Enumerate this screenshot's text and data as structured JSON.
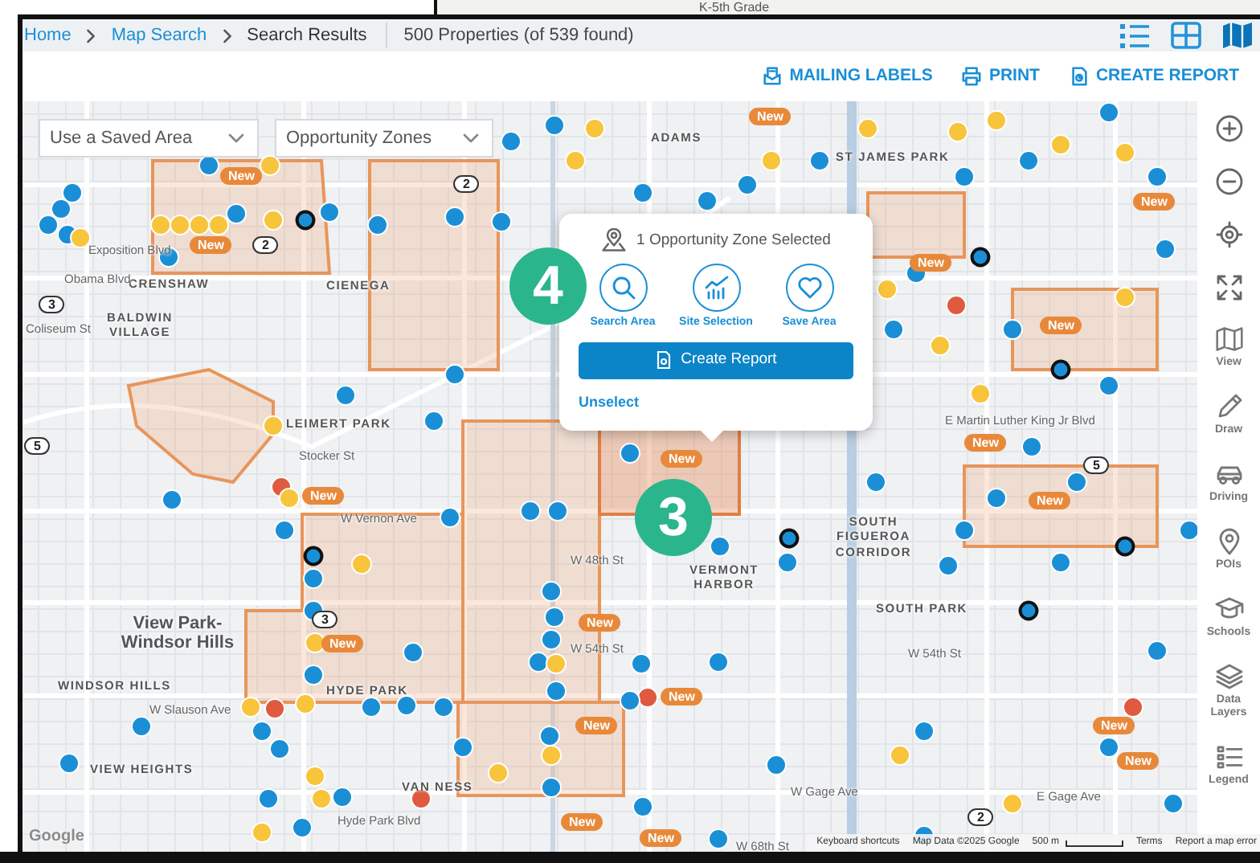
{
  "background_window": {
    "text": "K-5th Grade"
  },
  "breadcrumb": [
    {
      "label": "Home",
      "link": true
    },
    {
      "label": "Map Search",
      "link": true
    },
    {
      "label": "Search Results",
      "link": false
    }
  ],
  "result_count": "500 Properties (of 539 found)",
  "view_toggles": [
    {
      "kind": "list",
      "selected": false
    },
    {
      "kind": "grid",
      "selected": false
    },
    {
      "kind": "map",
      "selected": true
    }
  ],
  "actions": [
    {
      "kind": "mailing",
      "label": "MAILING LABELS"
    },
    {
      "kind": "print",
      "label": "PRINT"
    },
    {
      "kind": "report",
      "label": "CREATE REPORT"
    }
  ],
  "map": {
    "dropdowns": [
      {
        "value": "Use a Saved Area"
      },
      {
        "value": "Opportunity Zones"
      }
    ],
    "labels": [
      {
        "kind": "place",
        "text": "ADAMS"
      },
      {
        "kind": "place",
        "text": "ST JAMES PARK"
      },
      {
        "kind": "place",
        "text": "CRENSHAW"
      },
      {
        "kind": "place",
        "text": "BALDWIN VILLAGE"
      },
      {
        "kind": "place",
        "text": "LEIMERT PARK"
      },
      {
        "kind": "street",
        "text": "Obama Blvd"
      },
      {
        "kind": "street",
        "text": "Coliseum St"
      },
      {
        "kind": "street",
        "text": "Exposition Blvd"
      },
      {
        "kind": "street",
        "text": "Stocker St"
      },
      {
        "kind": "street",
        "text": "W Vernon Ave"
      },
      {
        "kind": "street",
        "text": "W 48th St"
      },
      {
        "kind": "street",
        "text": "W 54th St"
      },
      {
        "kind": "district",
        "text": "View Park-Windsor Hills"
      },
      {
        "kind": "place",
        "text": "WINDSOR HILLS"
      },
      {
        "kind": "street",
        "text": "W Slauson Ave"
      },
      {
        "kind": "place",
        "text": "HYDE PARK"
      },
      {
        "kind": "place",
        "text": "VIEW HEIGHTS"
      },
      {
        "kind": "place",
        "text": "VAN NESS"
      },
      {
        "kind": "street",
        "text": "Hyde Park Blvd"
      },
      {
        "kind": "place",
        "text": "VERMONT HARBOR"
      },
      {
        "kind": "place",
        "text": "SOUTH FIGUEROA CORRIDOR"
      },
      {
        "kind": "place",
        "text": "SOUTH PARK"
      },
      {
        "kind": "street",
        "text": "W 54th St"
      },
      {
        "kind": "street",
        "text": "W Gage Ave"
      },
      {
        "kind": "street",
        "text": "E Gage Ave"
      },
      {
        "kind": "street",
        "text": "W 68th St"
      },
      {
        "kind": "street",
        "text": "E Martin Luther King Jr Blvd"
      },
      {
        "kind": "place",
        "text": "CIENEGA"
      }
    ],
    "route_shields": [
      "2",
      "2",
      "3",
      "5",
      "3",
      "2",
      "5"
    ],
    "markers": [
      {
        "color": "#1b8fd6",
        "ringed": false
      },
      {
        "color": "#1b8fd6",
        "ringed": false
      },
      {
        "color": "#1b8fd6",
        "ringed": false
      },
      {
        "color": "#1b8fd6",
        "ringed": false
      },
      {
        "color": "#1b8fd6",
        "ringed": false
      },
      {
        "color": "#1b8fd6",
        "ringed": false
      },
      {
        "color": "#f8c43c",
        "ringed": false
      },
      {
        "color": "#f8c43c",
        "ringed": false
      },
      {
        "color": "#f8c43c",
        "ringed": false
      },
      {
        "color": "#f8c43c",
        "ringed": false
      },
      {
        "color": "#f8c43c",
        "ringed": false
      },
      {
        "color": "#1b8fd6",
        "ringed": false
      },
      {
        "color": "#f8c43c",
        "ringed": false
      },
      {
        "color": "#f8c43c",
        "ringed": false
      },
      {
        "color": "#1b8fd6",
        "ringed": false
      },
      {
        "color": "#1b8fd6",
        "ringed": true
      },
      {
        "color": "#1b8fd6",
        "ringed": false
      },
      {
        "color": "#1b8fd6",
        "ringed": false
      },
      {
        "color": "#1b8fd6",
        "ringed": false
      },
      {
        "color": "#1b8fd6",
        "ringed": false
      },
      {
        "color": "#1b8fd6",
        "ringed": false
      },
      {
        "color": "#f8c43c",
        "ringed": false
      },
      {
        "color": "#f8c43c",
        "ringed": false
      },
      {
        "color": "#1b8fd6",
        "ringed": false
      },
      {
        "color": "#1b8fd6",
        "ringed": false
      },
      {
        "color": "#1b8fd6",
        "ringed": false
      },
      {
        "color": "#f8c43c",
        "ringed": false
      },
      {
        "color": "#1b8fd6",
        "ringed": false
      },
      {
        "color": "#f8c43c",
        "ringed": false
      },
      {
        "color": "#f8c43c",
        "ringed": false
      },
      {
        "color": "#1b8fd6",
        "ringed": false
      },
      {
        "color": "#f8c43c",
        "ringed": false
      },
      {
        "color": "#1b8fd6",
        "ringed": false
      },
      {
        "color": "#f8c43c",
        "ringed": false
      },
      {
        "color": "#1b8fd6",
        "ringed": false
      },
      {
        "color": "#f8c43c",
        "ringed": false
      },
      {
        "color": "#1b8fd6",
        "ringed": false
      },
      {
        "color": "#1b8fd6",
        "ringed": true
      },
      {
        "color": "#e05a3f",
        "ringed": false
      },
      {
        "color": "#1b8fd6",
        "ringed": false
      },
      {
        "color": "#f8c43c",
        "ringed": false
      },
      {
        "color": "#1b8fd6",
        "ringed": false
      },
      {
        "color": "#f8c43c",
        "ringed": false
      },
      {
        "color": "#1b8fd6",
        "ringed": false
      },
      {
        "color": "#1b8fd6",
        "ringed": true
      },
      {
        "color": "#f8c43c",
        "ringed": false
      },
      {
        "color": "#1b8fd6",
        "ringed": false
      },
      {
        "color": "#f8c43c",
        "ringed": false
      },
      {
        "color": "#1b8fd6",
        "ringed": false
      },
      {
        "color": "#1b8fd6",
        "ringed": false
      },
      {
        "color": "#1b8fd6",
        "ringed": false
      },
      {
        "color": "#1b8fd6",
        "ringed": false
      },
      {
        "color": "#1b8fd6",
        "ringed": false
      },
      {
        "color": "#f8c43c",
        "ringed": false
      },
      {
        "color": "#e05a3f",
        "ringed": false
      },
      {
        "color": "#f8c43c",
        "ringed": false
      },
      {
        "color": "#1b8fd6",
        "ringed": false
      },
      {
        "color": "#1b8fd6",
        "ringed": false
      },
      {
        "color": "#1b8fd6",
        "ringed": false
      },
      {
        "color": "#1b8fd6",
        "ringed": false
      },
      {
        "color": "#1b8fd6",
        "ringed": false
      },
      {
        "color": "#1b8fd6",
        "ringed": true
      },
      {
        "color": "#f8c43c",
        "ringed": false
      },
      {
        "color": "#1b8fd6",
        "ringed": false
      },
      {
        "color": "#1b8fd6",
        "ringed": false
      },
      {
        "color": "#f8c43c",
        "ringed": false
      },
      {
        "color": "#1b8fd6",
        "ringed": false
      },
      {
        "color": "#1b8fd6",
        "ringed": false
      },
      {
        "color": "#1b8fd6",
        "ringed": false
      },
      {
        "color": "#1b8fd6",
        "ringed": false
      },
      {
        "color": "#1b8fd6",
        "ringed": false
      },
      {
        "color": "#1b8fd6",
        "ringed": false
      },
      {
        "color": "#f8c43c",
        "ringed": false
      },
      {
        "color": "#1b8fd6",
        "ringed": false
      },
      {
        "color": "#f8c43c",
        "ringed": false
      },
      {
        "color": "#e05a3f",
        "ringed": false
      },
      {
        "color": "#f8c43c",
        "ringed": false
      },
      {
        "color": "#1b8fd6",
        "ringed": false
      },
      {
        "color": "#1b8fd6",
        "ringed": false
      },
      {
        "color": "#1b8fd6",
        "ringed": false
      },
      {
        "color": "#1b8fd6",
        "ringed": false
      },
      {
        "color": "#1b8fd6",
        "ringed": false
      },
      {
        "color": "#1b8fd6",
        "ringed": false
      },
      {
        "color": "#1b8fd6",
        "ringed": false
      },
      {
        "color": "#1b8fd6",
        "ringed": false
      },
      {
        "color": "#1b8fd6",
        "ringed": false
      },
      {
        "color": "#f8c43c",
        "ringed": false
      },
      {
        "color": "#f8c43c",
        "ringed": false
      },
      {
        "color": "#1b8fd6",
        "ringed": false
      },
      {
        "color": "#e05a3f",
        "ringed": false
      },
      {
        "color": "#1b8fd6",
        "ringed": false
      },
      {
        "color": "#1b8fd6",
        "ringed": false
      },
      {
        "color": "#1b8fd6",
        "ringed": false
      },
      {
        "color": "#1b8fd6",
        "ringed": false
      },
      {
        "color": "#1b8fd6",
        "ringed": false
      },
      {
        "color": "#1b8fd6",
        "ringed": true
      },
      {
        "color": "#1b8fd6",
        "ringed": false
      },
      {
        "color": "#1b8fd6",
        "ringed": false
      },
      {
        "color": "#1b8fd6",
        "ringed": false
      },
      {
        "color": "#1b8fd6",
        "ringed": false
      },
      {
        "color": "#1b8fd6",
        "ringed": false
      },
      {
        "color": "#f8c43c",
        "ringed": false
      },
      {
        "color": "#f8c43c",
        "ringed": false
      },
      {
        "color": "#1b8fd6",
        "ringed": false
      },
      {
        "color": "#f8c43c",
        "ringed": false
      },
      {
        "color": "#1b8fd6",
        "ringed": false
      },
      {
        "color": "#e05a3f",
        "ringed": false
      },
      {
        "color": "#e05a3f",
        "ringed": false
      },
      {
        "color": "#1b8fd6",
        "ringed": false
      },
      {
        "color": "#1b8fd6",
        "ringed": false
      },
      {
        "color": "#f8c43c",
        "ringed": false
      },
      {
        "color": "#1b8fd6",
        "ringed": false
      },
      {
        "color": "#f8c43c",
        "ringed": false
      },
      {
        "color": "#1b8fd6",
        "ringed": false
      },
      {
        "color": "#1b8fd6",
        "ringed": false
      },
      {
        "color": "#1b8fd6",
        "ringed": true
      },
      {
        "color": "#1b8fd6",
        "ringed": false
      },
      {
        "color": "#1b8fd6",
        "ringed": true
      },
      {
        "color": "#1b8fd6",
        "ringed": false
      },
      {
        "color": "#1b8fd6",
        "ringed": false
      },
      {
        "color": "#1b8fd6",
        "ringed": false
      },
      {
        "color": "#1b8fd6",
        "ringed": false
      },
      {
        "color": "#1b8fd6",
        "ringed": false
      },
      {
        "color": "#1b8fd6",
        "ringed": false
      }
    ],
    "new_badges": [
      "New",
      "New",
      "New",
      "New",
      "New",
      "New",
      "New",
      "New",
      "New",
      "New",
      "New",
      "New",
      "New",
      "New",
      "New",
      "New",
      "New",
      "New"
    ],
    "step_badges": [
      "4",
      "3"
    ],
    "popup": {
      "title": "1 Opportunity Zone Selected",
      "actions": [
        {
          "kind": "search",
          "label": "Search Area"
        },
        {
          "kind": "site",
          "label": "Site Selection"
        },
        {
          "kind": "save",
          "label": "Save Area"
        }
      ],
      "primary_button": "Create Report",
      "link": "Unselect"
    },
    "google_logo": "Google",
    "attribution": [
      "Keyboard shortcuts",
      "Map Data ©2025 Google",
      "500 m",
      "Terms",
      "Report a map error"
    ]
  },
  "toolbar": [
    {
      "kind": "zoom-in"
    },
    {
      "kind": "zoom-out"
    },
    {
      "kind": "locate"
    },
    {
      "kind": "fullscreen"
    },
    {
      "kind": "view",
      "label": "View"
    },
    {
      "kind": "draw",
      "label": "Draw"
    },
    {
      "kind": "driving",
      "label": "Driving"
    },
    {
      "kind": "pois",
      "label": "POIs"
    },
    {
      "kind": "schools",
      "label": "Schools"
    },
    {
      "kind": "layers",
      "label": "Data Layers"
    },
    {
      "kind": "legend",
      "label": "Legend"
    }
  ]
}
